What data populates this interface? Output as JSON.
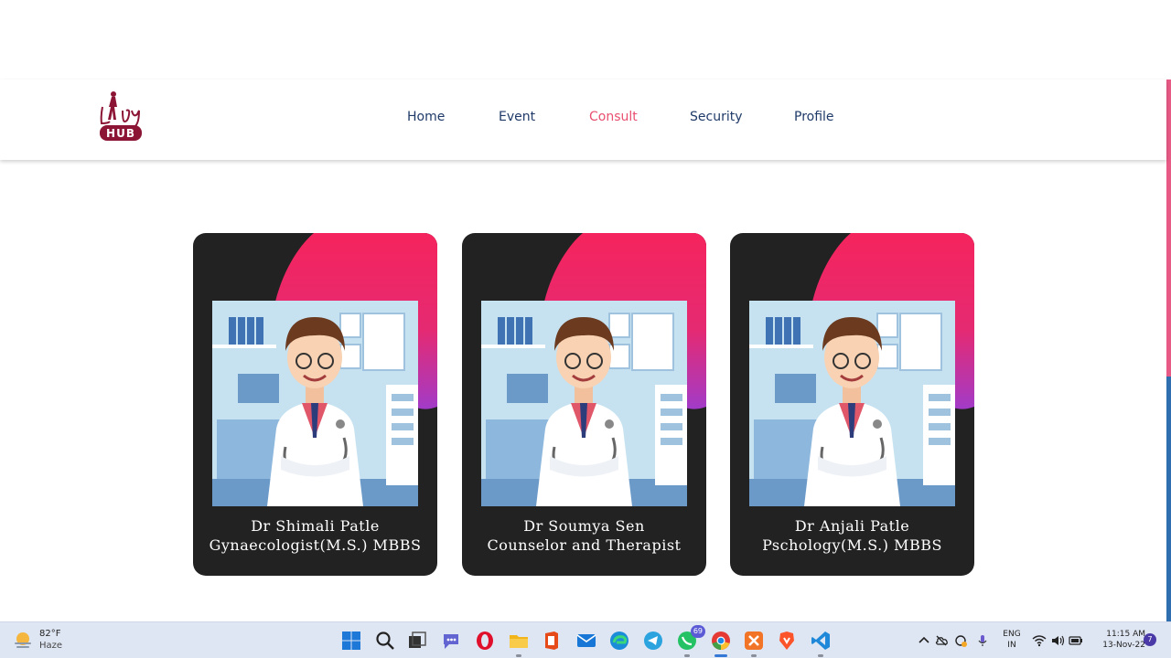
{
  "header": {
    "logo_text": "LADY HUB",
    "nav": [
      {
        "label": "Home"
      },
      {
        "label": "Event"
      },
      {
        "label": "Consult"
      },
      {
        "label": "Security"
      },
      {
        "label": "Profile"
      }
    ],
    "active_nav": "Consult"
  },
  "doctors": [
    {
      "name": "Dr Shimali Patle",
      "role": "Gynaecologist(M.S.) MBBS"
    },
    {
      "name": "Dr Soumya Sen",
      "role": "Counselor and Therapist"
    },
    {
      "name": "Dr Anjali Patle",
      "role": "Pschology(M.S.) MBBS"
    }
  ],
  "colors": {
    "nav_text": "#1f3a68",
    "nav_active": "#e84f70",
    "card_bg": "#222222",
    "card_accent_from": "#f5245d",
    "card_accent_to": "#a23bc8",
    "logo": "#8c1535"
  },
  "taskbar": {
    "weather": {
      "temp": "82°F",
      "condition": "Haze"
    },
    "apps": [
      {
        "name": "windows-start-icon"
      },
      {
        "name": "search-icon"
      },
      {
        "name": "task-view-icon"
      },
      {
        "name": "teams-chat-icon"
      },
      {
        "name": "opera-icon"
      },
      {
        "name": "file-explorer-icon"
      },
      {
        "name": "office-icon"
      },
      {
        "name": "mail-icon"
      },
      {
        "name": "edge-icon"
      },
      {
        "name": "telegram-icon"
      },
      {
        "name": "whatsapp-icon",
        "badge": "69"
      },
      {
        "name": "chrome-icon"
      },
      {
        "name": "xampp-icon"
      },
      {
        "name": "brave-icon"
      },
      {
        "name": "vscode-icon"
      }
    ],
    "language": {
      "line1": "ENG",
      "line2": "IN"
    },
    "clock": {
      "time": "11:15 AM",
      "date": "13-Nov-22"
    },
    "notifications": "7"
  }
}
